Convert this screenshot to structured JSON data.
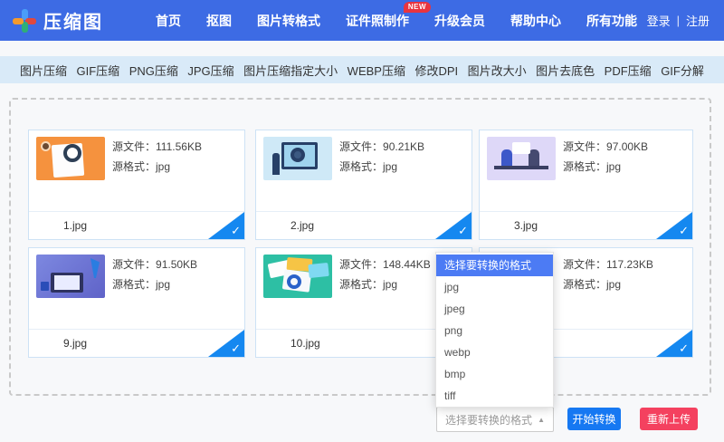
{
  "brand": {
    "title": "压缩图"
  },
  "navbar": {
    "items": [
      {
        "label": "首页"
      },
      {
        "label": "抠图"
      },
      {
        "label": "图片转格式"
      },
      {
        "label": "证件照制作",
        "badge": "NEW"
      },
      {
        "label": "升级会员"
      },
      {
        "label": "帮助中心"
      },
      {
        "label": "所有功能"
      }
    ],
    "login": "登录",
    "divider": "|",
    "register": "注册"
  },
  "tabbar": {
    "items": [
      "图片压缩",
      "GIF压缩",
      "PNG压缩",
      "JPG压缩",
      "图片压缩指定大小",
      "WEBP压缩",
      "修改DPI",
      "图片改大小",
      "图片去底色",
      "PDF压缩",
      "GIF分解"
    ]
  },
  "labels": {
    "source_file": "源文件：",
    "source_format": "源格式："
  },
  "cards": [
    {
      "filename": "1.jpg",
      "size": "111.56KB",
      "format": "jpg"
    },
    {
      "filename": "2.jpg",
      "size": "90.21KB",
      "format": "jpg"
    },
    {
      "filename": "3.jpg",
      "size": "97.00KB",
      "format": "jpg"
    },
    {
      "filename": "9.jpg",
      "size": "91.50KB",
      "format": "jpg"
    },
    {
      "filename": "10.jpg",
      "size": "148.44KB",
      "format": "jpg"
    },
    {
      "filename": "",
      "size": "117.23KB",
      "format": "jpg"
    }
  ],
  "dropdown": {
    "header": "选择要转换的格式",
    "options": [
      "jpg",
      "jpeg",
      "png",
      "webp",
      "bmp",
      "tiff"
    ]
  },
  "controls": {
    "select_placeholder": "选择要转换的格式",
    "convert_label": "开始转换",
    "reupload_label": "重新上传"
  },
  "icons": {
    "check": "✓",
    "dropdown_arrow_up": "▲"
  },
  "colors": {
    "navbar_blue": "#3d6be4",
    "tabbar_bg": "#d9eaf8",
    "check_blue": "#1588f0",
    "dropdown_header_blue": "#4c7bf4",
    "convert_button_blue": "#1678f2",
    "reupload_button_red": "#f4415f",
    "new_badge_red": "#e8343f"
  }
}
